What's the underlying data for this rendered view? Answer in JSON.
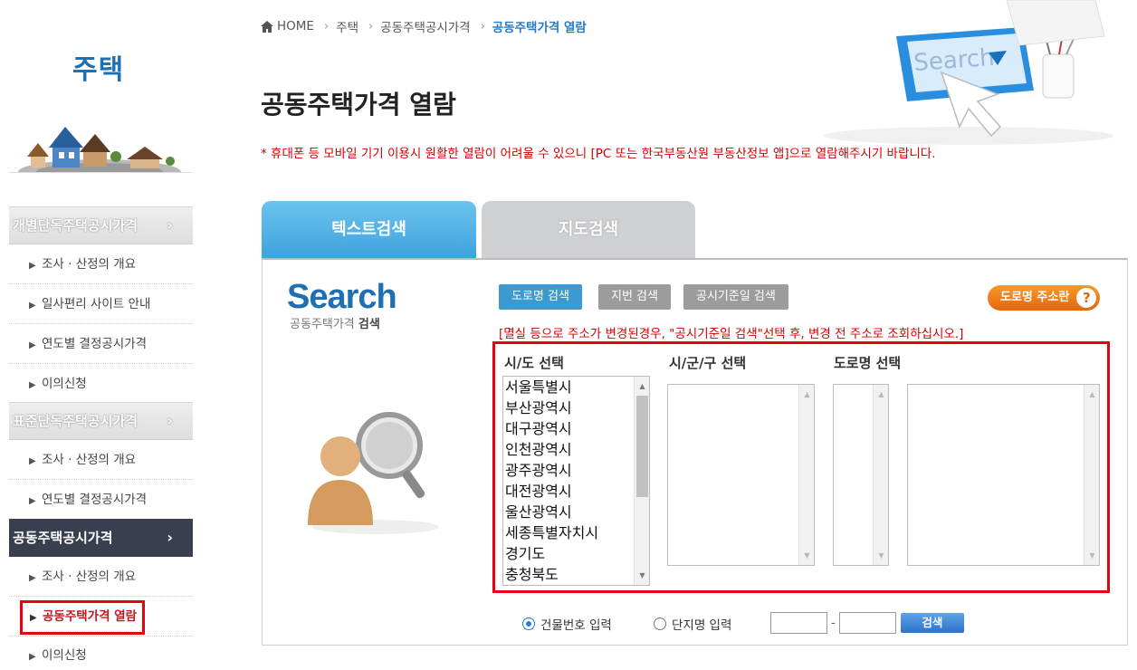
{
  "sidebar": {
    "title": "주택",
    "sections": [
      {
        "label": "개별단독주택공시가격",
        "items": [
          {
            "label": "조사 · 산정의 개요"
          },
          {
            "label": "일사편리 사이트 안내"
          },
          {
            "label": "연도별 결정공시가격"
          },
          {
            "label": "이의신청"
          }
        ]
      },
      {
        "label": "표준단독주택공시가격",
        "items": [
          {
            "label": "조사 · 산정의 개요"
          },
          {
            "label": "연도별 결정공시가격"
          }
        ]
      },
      {
        "label": "공동주택공시가격",
        "items": [
          {
            "label": "조사 · 산정의 개요"
          },
          {
            "label": "공동주택가격 열람"
          },
          {
            "label": "이의신청"
          }
        ]
      }
    ],
    "chevron": "›",
    "bullet": "▶"
  },
  "breadcrumb": {
    "home": "HOME",
    "items": [
      "주택",
      "공동주택공시가격"
    ],
    "current": "공동주택가격 열람",
    "separator": "›"
  },
  "page": {
    "title": "공동주택가격 열람",
    "notice": "* 휴대폰 등 모바일 기기 이용시 원활한 열람이 어려울 수 있으니 [PC 또는 한국부동산원 부동산정보 앱]으로 열람해주시기 바랍니다."
  },
  "hero": {
    "search_text": "Search"
  },
  "tabs": {
    "text_search": "텍스트검색",
    "map_search": "지도검색"
  },
  "panel": {
    "logo": "Search",
    "logo_sub_normal": "공동주택가격",
    "logo_sub_bold": "검색",
    "buttons": {
      "road": "도로명 검색",
      "jibun": "지번 검색",
      "date": "공시기준일 검색",
      "addr_help": "도로명 주소란",
      "addr_help_icon": "?"
    },
    "warning": "[멸실 등으로 주소가 변경된경우, \"공시기준일 검색\"선택 후, 변경 전 주소로 조회하십시오.]",
    "columns": {
      "sido": "시/도 선택",
      "sigungu": "시/군/구 선택",
      "road": "도로명 선택"
    },
    "sido_options": [
      "서울특별시",
      "부산광역시",
      "대구광역시",
      "인천광역시",
      "광주광역시",
      "대전광역시",
      "울산광역시",
      "세종특별자치시",
      "경기도",
      "충청북도"
    ],
    "radio": {
      "building_no": "건물번호 입력",
      "complex_name": "단지명 입력",
      "selected": "building_no"
    },
    "dash": "-",
    "search_button": "검색"
  },
  "colors": {
    "accent_blue": "#1f6fb3",
    "tab_active": "#3ea2de",
    "warning_red": "#d40000",
    "highlight_red": "#e60012",
    "addr_orange": "#e5650e"
  }
}
